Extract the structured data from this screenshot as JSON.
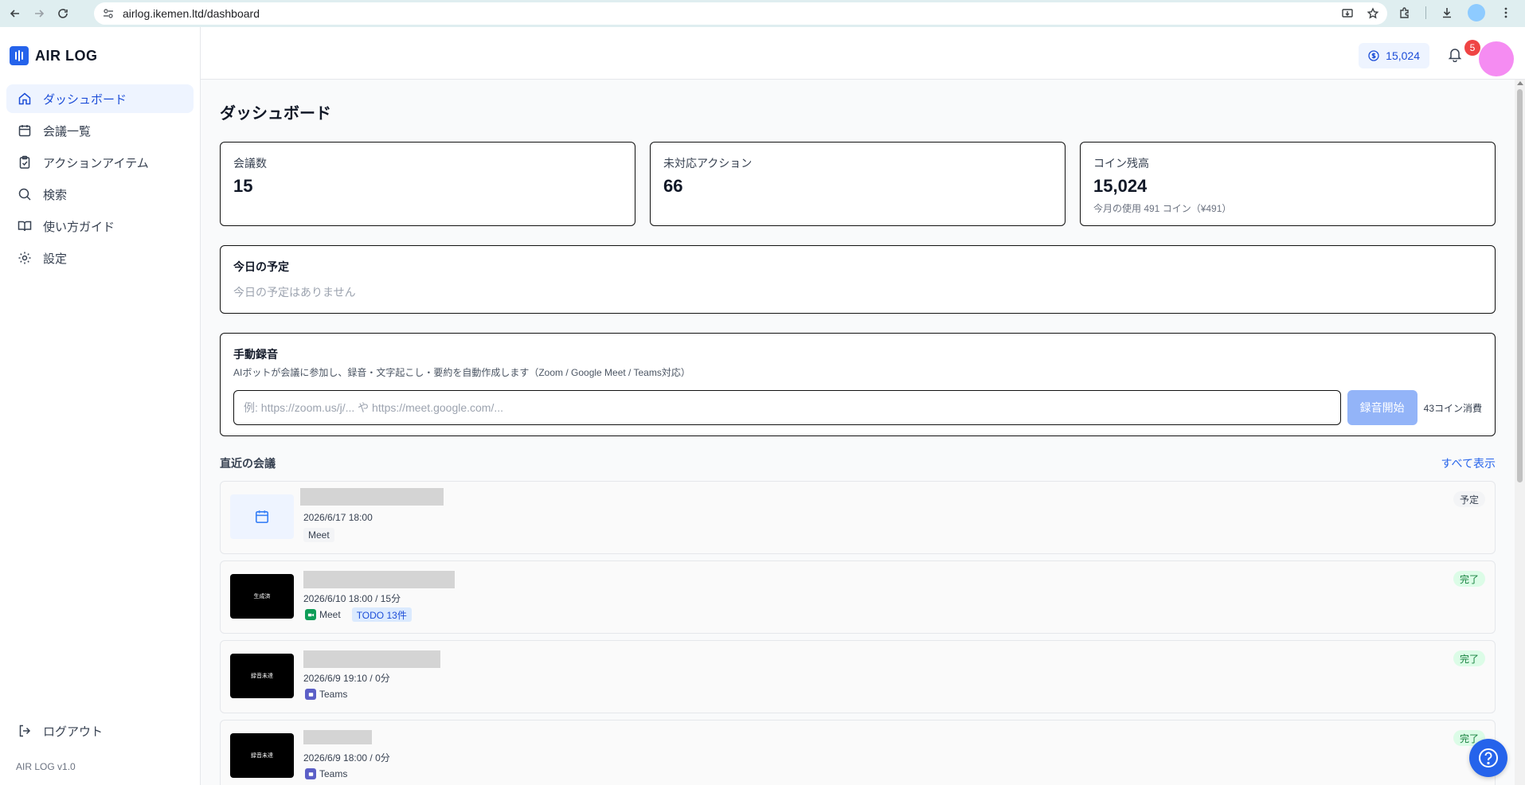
{
  "browser": {
    "url": "airlog.ikemen.ltd/dashboard"
  },
  "app": {
    "name": "AIR LOG",
    "version": "AIR LOG v1.0"
  },
  "sidebar": {
    "items": [
      {
        "label": "ダッシュボード",
        "icon": "home-icon",
        "active": true
      },
      {
        "label": "会議一覧",
        "icon": "calendar-icon"
      },
      {
        "label": "アクションアイテム",
        "icon": "clipboard-check-icon"
      },
      {
        "label": "検索",
        "icon": "search-icon"
      },
      {
        "label": "使い方ガイド",
        "icon": "book-open-icon"
      },
      {
        "label": "設定",
        "icon": "gear-icon"
      }
    ],
    "logout_label": "ログアウト"
  },
  "header": {
    "coin_balance": "15,024",
    "notification_count": "5"
  },
  "page": {
    "title": "ダッシュボード"
  },
  "stats": [
    {
      "label": "会議数",
      "value": "15"
    },
    {
      "label": "未対応アクション",
      "value": "66"
    },
    {
      "label": "コイン残高",
      "value": "15,024",
      "sub": "今月の使用 491 コイン（¥491）"
    }
  ],
  "today": {
    "title": "今日の予定",
    "empty": "今日の予定はありません"
  },
  "recording": {
    "title": "手動録音",
    "description": "AIボットが会議に参加し、録音・文字起こし・要約を自動作成します（Zoom / Google Meet / Teams対応）",
    "placeholder": "例: https://zoom.us/j/... や https://meet.google.com/...",
    "button_label": "録音開始",
    "cost": "43コイン消費"
  },
  "recent": {
    "title": "直近の会議",
    "show_all": "すべて表示",
    "meetings": [
      {
        "date": "2026/6/17 18:00",
        "platform": "Meet",
        "status": "予定",
        "thumb": "calendar"
      },
      {
        "date": "2026/6/10 18:00 / 15分",
        "platform": "Meet",
        "todo": "TODO 13件",
        "status": "完了",
        "thumb": "video",
        "thumb_text": "生成済"
      },
      {
        "date": "2026/6/9 19:10 / 0分",
        "platform": "Teams",
        "status": "完了",
        "thumb": "video",
        "thumb_text": "録音未達"
      },
      {
        "date": "2026/6/9 18:00 / 0分",
        "platform": "Teams",
        "status": "完了",
        "thumb": "video",
        "thumb_text": "録音未達"
      }
    ]
  }
}
